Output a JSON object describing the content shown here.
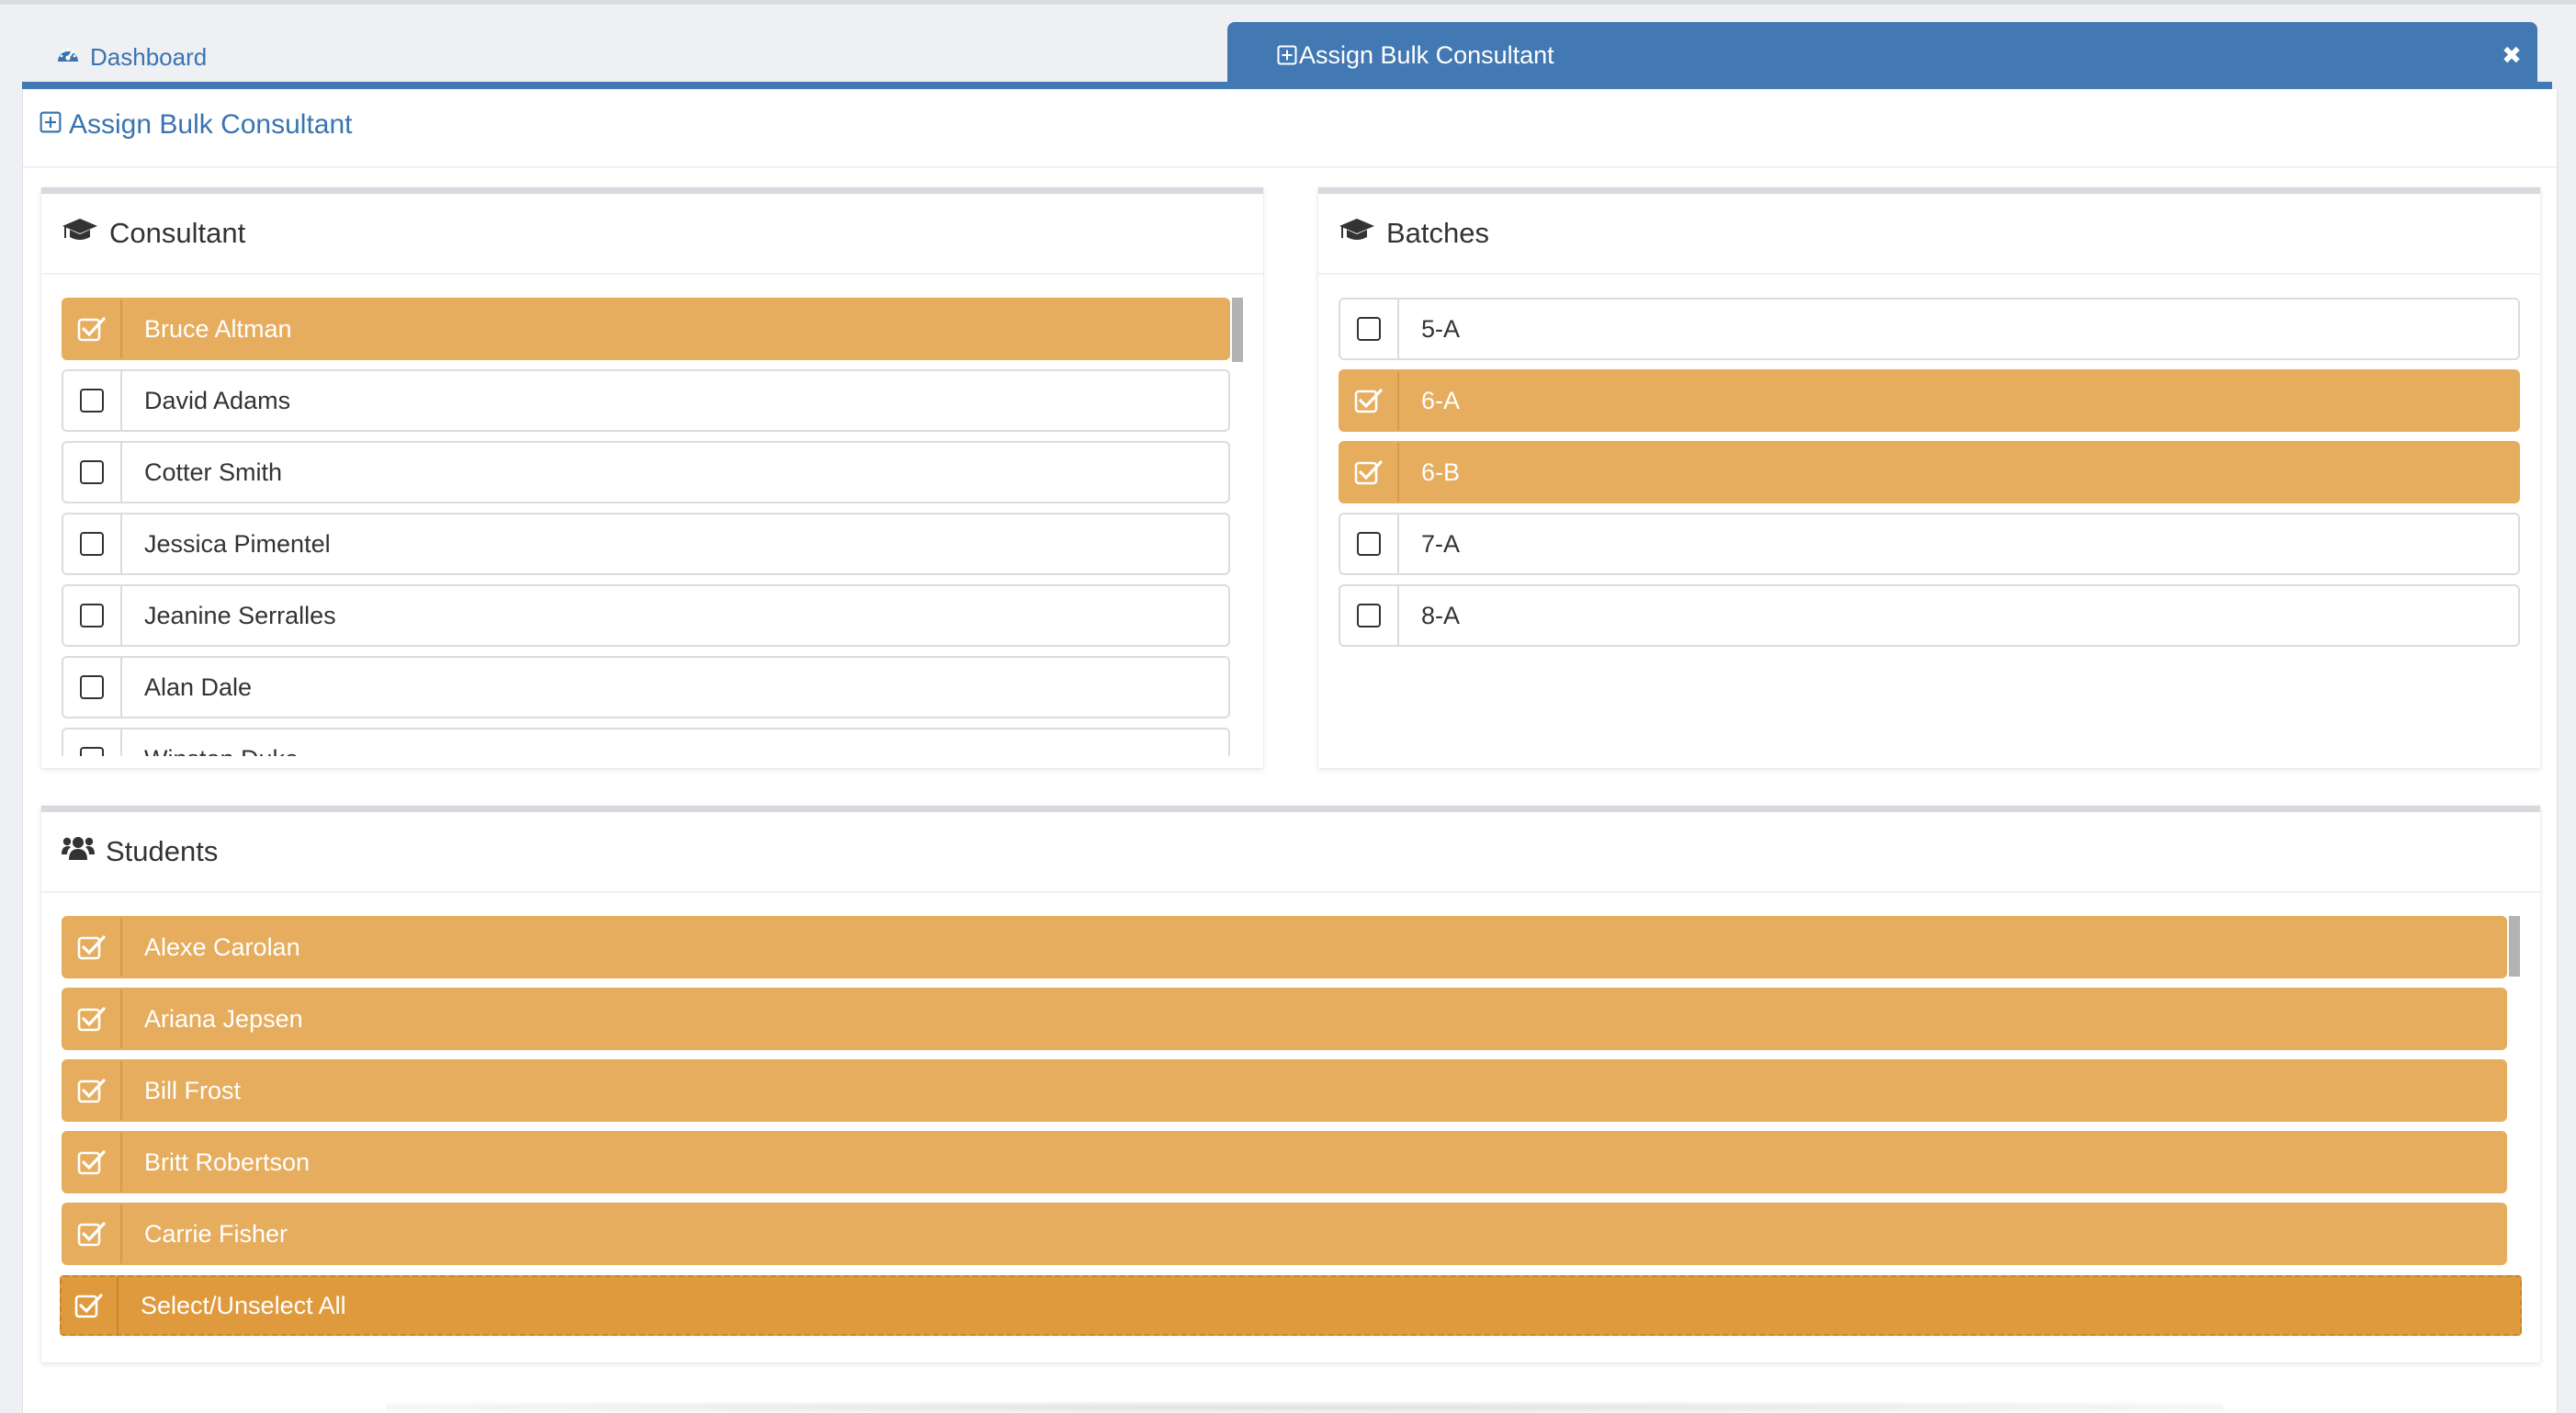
{
  "tabs": {
    "dashboard": "Dashboard",
    "active": "Assign Bulk Consultant",
    "close_glyph": "✖"
  },
  "page": {
    "title": "Assign Bulk Consultant"
  },
  "consultant": {
    "title": "Consultant",
    "icon": "graduation-cap-icon",
    "items": [
      {
        "label": "Bruce Altman",
        "checked": true
      },
      {
        "label": "David Adams",
        "checked": false
      },
      {
        "label": "Cotter Smith",
        "checked": false
      },
      {
        "label": "Jessica Pimentel",
        "checked": false
      },
      {
        "label": "Jeanine Serralles",
        "checked": false
      },
      {
        "label": "Alan Dale",
        "checked": false
      },
      {
        "label": "Winston Duke",
        "checked": false
      }
    ]
  },
  "batches": {
    "title": "Batches",
    "icon": "graduation-cap-icon",
    "items": [
      {
        "label": "5-A",
        "checked": false
      },
      {
        "label": "6-A",
        "checked": true
      },
      {
        "label": "6-B",
        "checked": true
      },
      {
        "label": "7-A",
        "checked": false
      },
      {
        "label": "8-A",
        "checked": false
      }
    ]
  },
  "students": {
    "title": "Students",
    "icon": "users-icon",
    "items": [
      {
        "label": "Alexe Carolan",
        "checked": true
      },
      {
        "label": "Ariana Jepsen",
        "checked": true
      },
      {
        "label": "Bill Frost",
        "checked": true
      },
      {
        "label": "Britt Robertson",
        "checked": true
      },
      {
        "label": "Carrie Fisher",
        "checked": true
      }
    ],
    "select_all": {
      "label": "Select/Unselect All",
      "checked": true
    }
  },
  "colors": {
    "accent": "#4379b3",
    "selected": "#e6ad5e",
    "select_all": "#de9a3d"
  }
}
